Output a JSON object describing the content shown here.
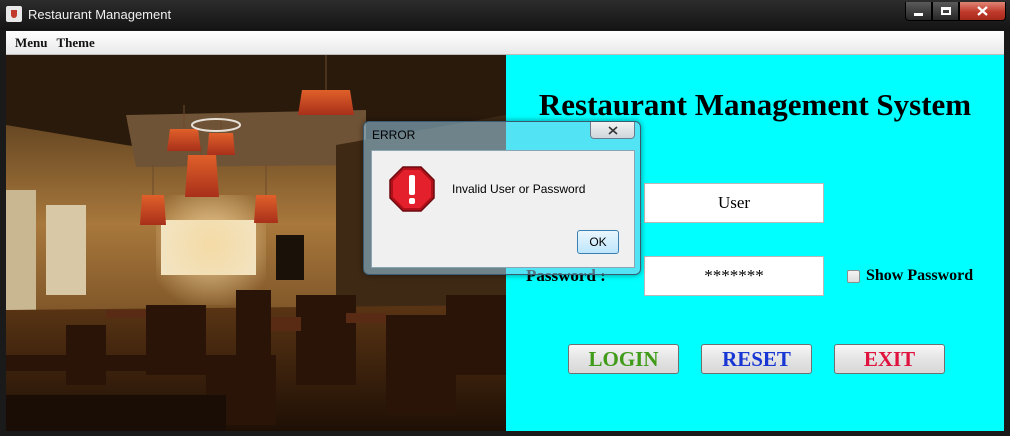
{
  "window": {
    "title": "Restaurant Management",
    "icon": "java-cup-icon",
    "controls": [
      "minimize",
      "maximize",
      "close"
    ]
  },
  "menubar": {
    "items": [
      "Menu",
      "Theme"
    ]
  },
  "login": {
    "system_title": "Restaurant Management System",
    "user_value": "User",
    "password_label": "Password :",
    "password_value": "*******",
    "show_password_label": "Show Password",
    "show_password_checked": false,
    "buttons": {
      "login": "LOGIN",
      "reset": "RESET",
      "exit": "EXIT"
    },
    "background_color": "#00FFFF",
    "button_colors": {
      "login": "#3f9b18",
      "reset": "#1836d4",
      "exit": "#e0123e"
    }
  },
  "dialog": {
    "title": "ERROR",
    "message": "Invalid User or Password",
    "ok_label": "OK",
    "icon": "error-stop-icon"
  }
}
